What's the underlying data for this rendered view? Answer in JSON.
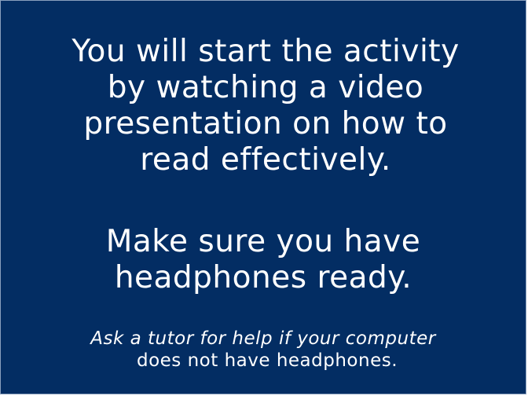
{
  "slide": {
    "background_color": "#032D63",
    "text_color": "#FFFFFF",
    "intro": {
      "line1": "You will start the activity",
      "line2": "by watching a video",
      "line3": "presentation on how to",
      "line4": "read effectively."
    },
    "reminder": {
      "line1": "Make sure you have",
      "line2": "headphones ready."
    },
    "help": {
      "line1": "Ask a tutor for help if your computer",
      "line2": "does not have headphones."
    }
  }
}
